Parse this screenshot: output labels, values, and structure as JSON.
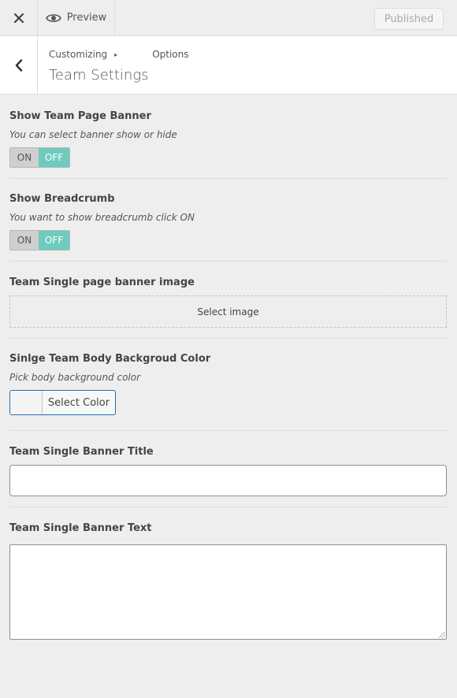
{
  "topbar": {
    "close_label": "×",
    "preview_label": "Preview",
    "published_label": "Published"
  },
  "header": {
    "breadcrumb_customizing": "Customizing",
    "breadcrumb_separator": "▸",
    "breadcrumb_options": "Options",
    "title": "Team Settings"
  },
  "controls": {
    "banner": {
      "label": "Show Team Page Banner",
      "description": "You can select banner show or hide",
      "on_label": "ON",
      "off_label": "OFF"
    },
    "breadcrumb": {
      "label": "Show Breadcrumb",
      "description": "You want to show breadcrumb click ON",
      "on_label": "ON",
      "off_label": "OFF"
    },
    "banner_image": {
      "label": "Team Single page banner image",
      "button_label": "Select image"
    },
    "body_color": {
      "label": "Sinlge Team Body Backgroud Color",
      "description": "Pick body background color",
      "button_label": "Select Color"
    },
    "banner_title": {
      "label": "Team Single Banner Title",
      "value": ""
    },
    "banner_text": {
      "label": "Team Single Banner Text",
      "value": ""
    }
  },
  "colors": {
    "toggle_off_active": "#6fcbbd",
    "toggle_on_inactive": "#cfcfcf",
    "color_button_border": "#2271b1"
  }
}
